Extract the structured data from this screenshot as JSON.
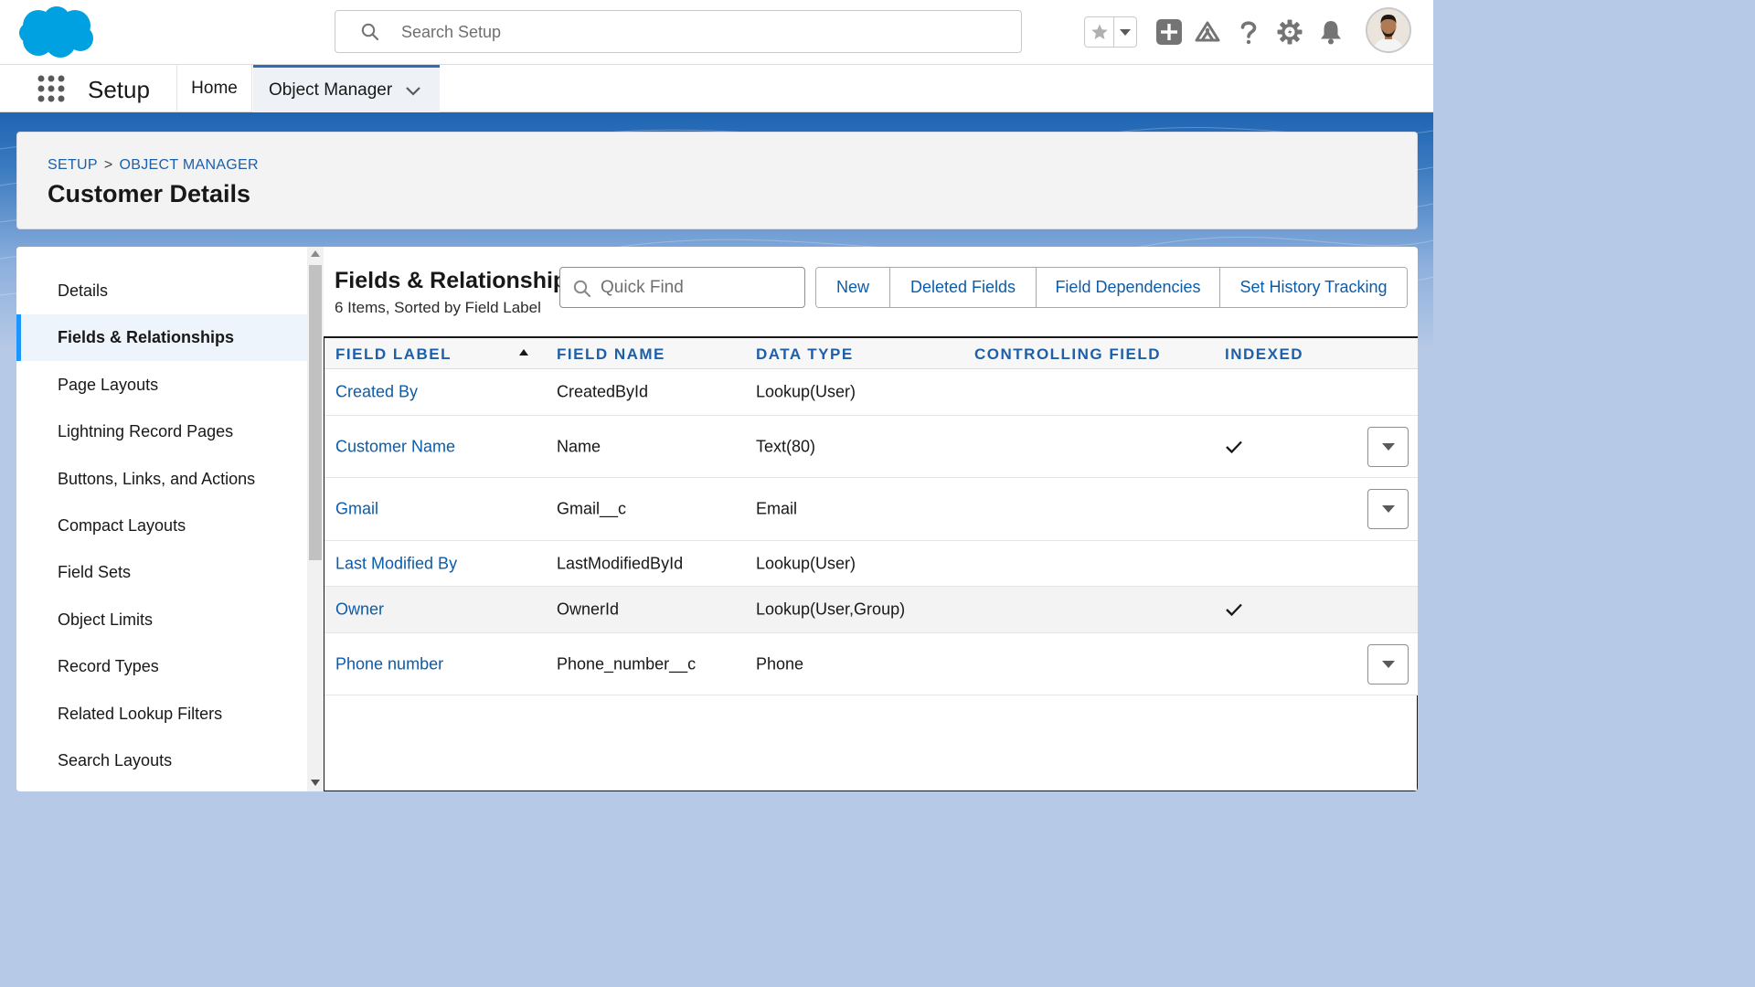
{
  "header": {
    "search_placeholder": "Search Setup",
    "icons": [
      "salesforce-logo",
      "favorites-star-icon",
      "chevron-down-icon",
      "add-icon",
      "trailhead-icon",
      "help-icon",
      "gear-icon",
      "bell-icon",
      "avatar"
    ]
  },
  "nav": {
    "app_name": "Setup",
    "tabs": [
      {
        "label": "Home",
        "active": false
      },
      {
        "label": "Object Manager",
        "active": true
      }
    ]
  },
  "page_header": {
    "breadcrumb": [
      "SETUP",
      "OBJECT MANAGER"
    ],
    "breadcrumb_separator": ">",
    "title": "Customer Details"
  },
  "sidebar": {
    "items": [
      {
        "label": "Details",
        "active": false
      },
      {
        "label": "Fields & Relationships",
        "active": true
      },
      {
        "label": "Page Layouts",
        "active": false
      },
      {
        "label": "Lightning Record Pages",
        "active": false
      },
      {
        "label": "Buttons, Links, and Actions",
        "active": false
      },
      {
        "label": "Compact Layouts",
        "active": false
      },
      {
        "label": "Field Sets",
        "active": false
      },
      {
        "label": "Object Limits",
        "active": false
      },
      {
        "label": "Record Types",
        "active": false
      },
      {
        "label": "Related Lookup Filters",
        "active": false
      },
      {
        "label": "Search Layouts",
        "active": false
      }
    ]
  },
  "section": {
    "title": "Fields & Relationships",
    "subtitle": "6 Items, Sorted by Field Label",
    "quick_find_placeholder": "Quick Find",
    "buttons": [
      "New",
      "Deleted Fields",
      "Field Dependencies",
      "Set History Tracking"
    ]
  },
  "table": {
    "columns": [
      "FIELD LABEL",
      "FIELD NAME",
      "DATA TYPE",
      "CONTROLLING FIELD",
      "INDEXED"
    ],
    "sorted_column": "FIELD LABEL",
    "sort_direction": "ascending",
    "rows": [
      {
        "label": "Created By",
        "name": "CreatedById",
        "type": "Lookup(User)",
        "controlling": "",
        "indexed": false,
        "menu": false
      },
      {
        "label": "Customer Name",
        "name": "Name",
        "type": "Text(80)",
        "controlling": "",
        "indexed": true,
        "menu": true
      },
      {
        "label": "Gmail",
        "name": "Gmail__c",
        "type": "Email",
        "controlling": "",
        "indexed": false,
        "menu": true
      },
      {
        "label": "Last Modified By",
        "name": "LastModifiedById",
        "type": "Lookup(User)",
        "controlling": "",
        "indexed": false,
        "menu": false
      },
      {
        "label": "Owner",
        "name": "OwnerId",
        "type": "Lookup(User,Group)",
        "controlling": "",
        "indexed": true,
        "menu": false,
        "highlighted": true
      },
      {
        "label": "Phone number",
        "name": "Phone_number__c",
        "type": "Phone",
        "controlling": "",
        "indexed": false,
        "menu": true
      }
    ]
  },
  "colors": {
    "brand_blue": "#1b96ff",
    "link_blue": "#0b5cab",
    "band_blue": "#1f65b3",
    "cloud_blue": "#00a1e0"
  }
}
